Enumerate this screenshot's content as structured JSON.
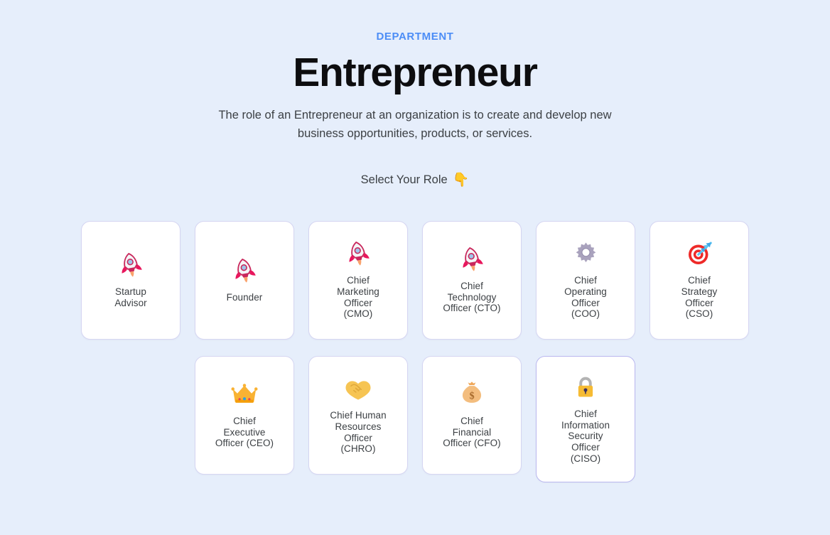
{
  "header": {
    "eyebrow": "DEPARTMENT",
    "title": "Entrepreneur",
    "subtitle": "The role of an Entrepreneur at an organization is to create and develop new business opportunities, products, or services.",
    "select_prompt": "Select Your Role",
    "select_emoji": "👇"
  },
  "colors": {
    "page_background": "#e6eefb",
    "eyebrow": "#4c8df6",
    "title": "#0d0d0f",
    "body_text": "#3c4044",
    "card_background": "#ffffff",
    "card_border": "#d5d5f2",
    "card_border_active": "#b9b6ef"
  },
  "roles": {
    "row1": [
      {
        "label": "Startup\nAdvisor",
        "icon": "rocket-icon",
        "active": false
      },
      {
        "label": "Founder",
        "icon": "rocket-icon",
        "active": false
      },
      {
        "label": "Chief\nMarketing\nOfficer\n(CMO)",
        "icon": "rocket-icon",
        "active": false
      },
      {
        "label": "Chief\nTechnology\nOfficer (CTO)",
        "icon": "rocket-icon",
        "active": false
      },
      {
        "label": "Chief\nOperating\nOfficer\n(COO)",
        "icon": "gear-icon",
        "active": false
      },
      {
        "label": "Chief\nStrategy\nOfficer\n(CSO)",
        "icon": "dart-icon",
        "active": false
      }
    ],
    "row2": [
      {
        "label": "Chief\nExecutive\nOfficer (CEO)",
        "icon": "crown-icon",
        "active": false
      },
      {
        "label": "Chief Human\nResources\nOfficer\n(CHRO)",
        "icon": "handshake-icon",
        "active": false
      },
      {
        "label": "Chief\nFinancial\nOfficer (CFO)",
        "icon": "moneybag-icon",
        "active": false
      },
      {
        "label": "Chief\nInformation\nSecurity\nOfficer\n(CISO)",
        "icon": "lock-icon",
        "active": true
      }
    ]
  }
}
